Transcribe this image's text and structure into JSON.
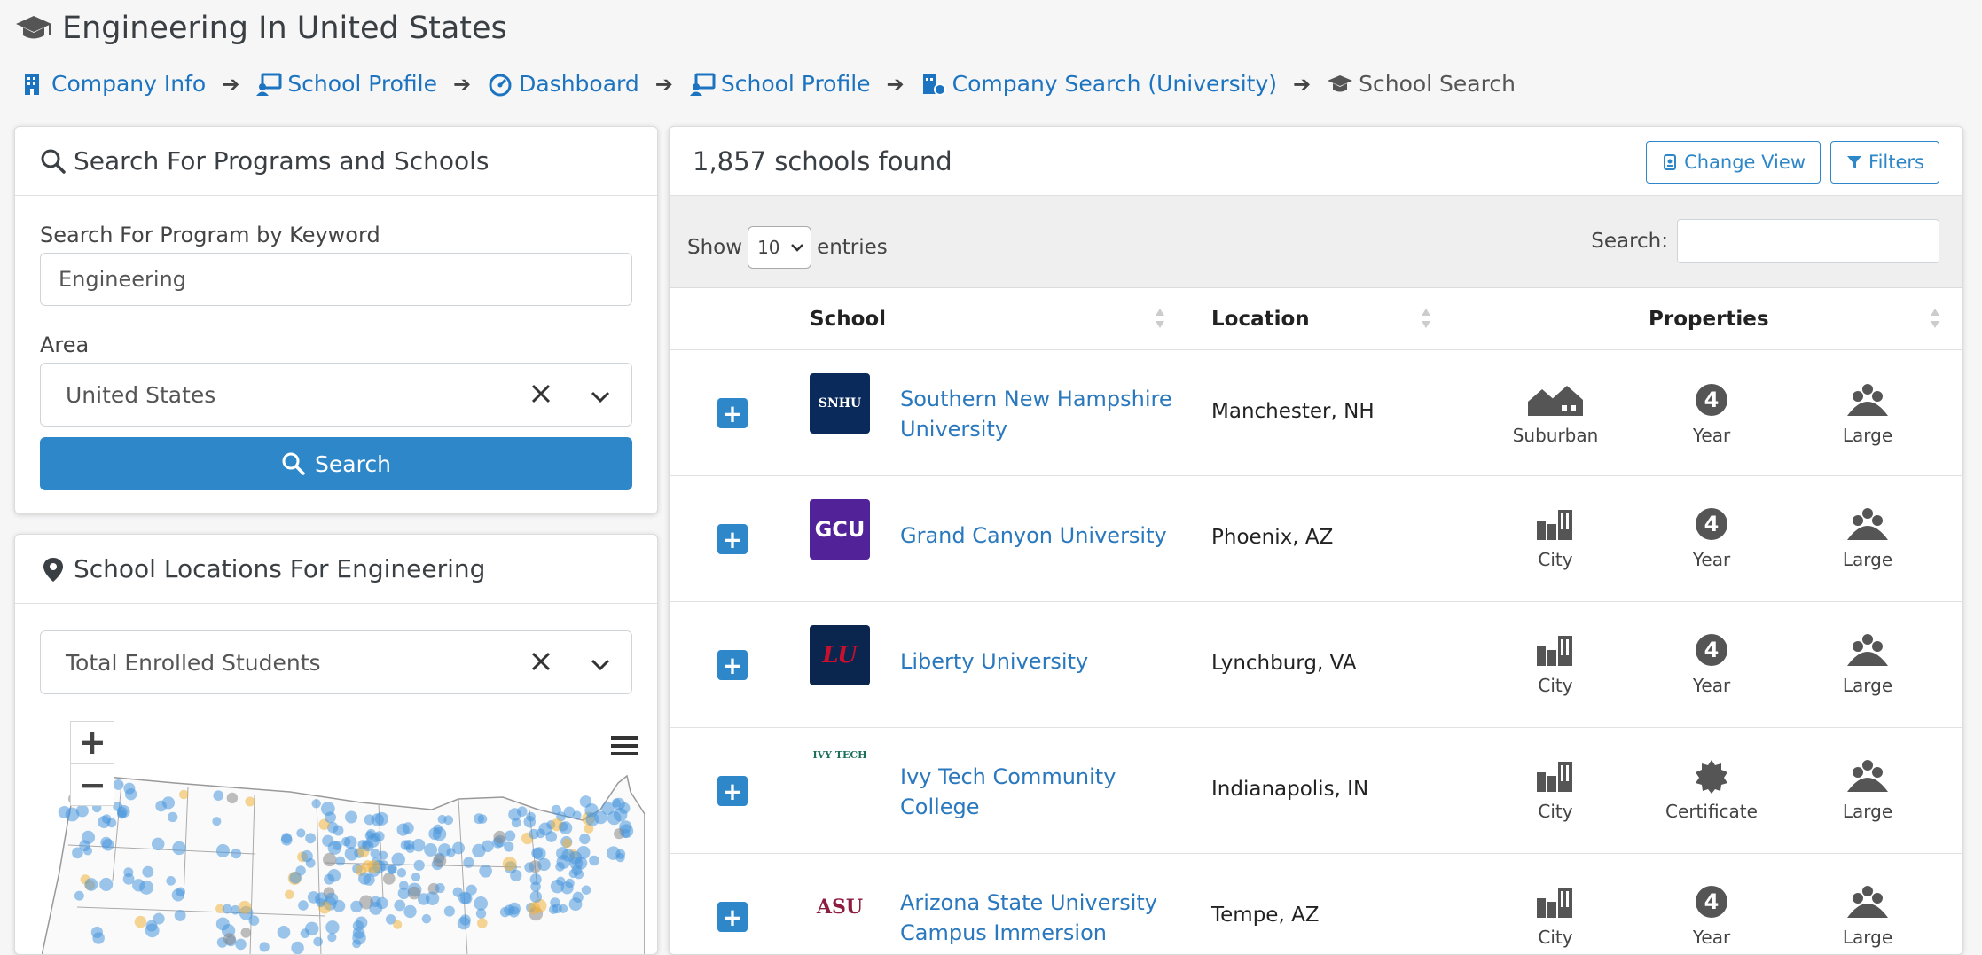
{
  "page": {
    "title": "Engineering In United States"
  },
  "breadcrumbs": [
    {
      "label": "Company Info",
      "icon": "building-icon"
    },
    {
      "label": "School Profile",
      "icon": "chalkboard-user-icon"
    },
    {
      "label": "Dashboard",
      "icon": "dashboard-gauge-icon"
    },
    {
      "label": "School Profile",
      "icon": "chalkboard-user-icon"
    },
    {
      "label": "Company Search (University)",
      "icon": "building-search-icon"
    },
    {
      "label": "School Search",
      "icon": "graduation-cap-icon"
    }
  ],
  "search_panel": {
    "heading": "Search For Programs and Schools",
    "keyword_label": "Search For Program by Keyword",
    "keyword_value": "Engineering",
    "area_label": "Area",
    "area_value": "United States",
    "search_button": "Search"
  },
  "map_panel": {
    "heading": "School Locations For Engineering",
    "metric_value": "Total Enrolled Students",
    "zoom_in": "+",
    "zoom_out": "−"
  },
  "results": {
    "count_text": "1,857 schools found",
    "change_view": "Change View",
    "filters": "Filters",
    "show_label": "Show",
    "entries_value": "10",
    "entries_label": "entries",
    "search_label": "Search:",
    "search_value": "",
    "columns": [
      "School",
      "Location",
      "Properties"
    ],
    "rows": [
      {
        "logo": "SNHU",
        "name_line1": "Southern New Hampshire",
        "name_line2": "University",
        "location": "Manchester, NH",
        "setting": "Suburban",
        "level": "Year",
        "size": "Large"
      },
      {
        "logo": "GCU",
        "name_line1": "Grand Canyon University",
        "name_line2": "",
        "location": "Phoenix, AZ",
        "setting": "City",
        "level": "Year",
        "size": "Large"
      },
      {
        "logo": "LU",
        "name_line1": "Liberty University",
        "name_line2": "",
        "location": "Lynchburg, VA",
        "setting": "City",
        "level": "Year",
        "size": "Large"
      },
      {
        "logo": "IVY TECH",
        "name_line1": "Ivy Tech Community",
        "name_line2": "College",
        "location": "Indianapolis, IN",
        "setting": "City",
        "level": "Certificate",
        "size": "Large"
      },
      {
        "logo": "ASU",
        "name_line1": "Arizona State University",
        "name_line2": "Campus Immersion",
        "location": "Tempe, AZ",
        "setting": "City",
        "level": "Year",
        "size": "Large"
      }
    ]
  },
  "colors": {
    "accent": "#2e87c8",
    "link": "#2a78bd",
    "snhu": "#0a2a5c",
    "gcu": "#522398",
    "liberty": "#0a254e",
    "asu": "#8c1d40"
  }
}
